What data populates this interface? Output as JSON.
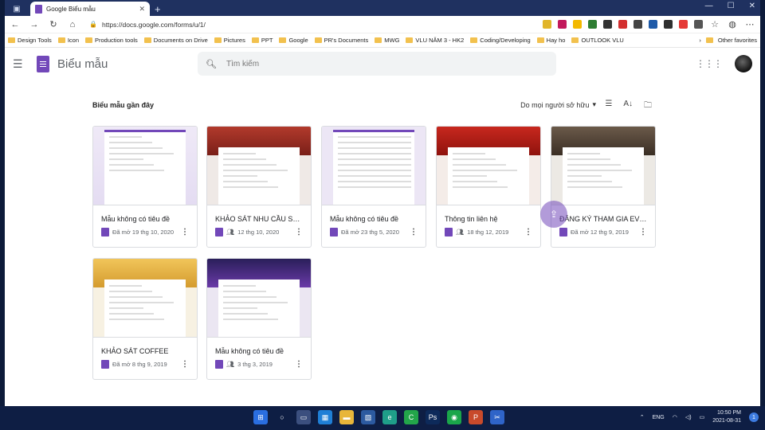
{
  "browser": {
    "tab_title": "Google Biểu mẫu",
    "tab_close": "✕",
    "new_tab": "+",
    "window_controls": [
      "—",
      "☐",
      "✕"
    ],
    "url": "https://docs.google.com/forms/u/1/",
    "bookmarks": [
      "Design Tools",
      "Icon",
      "Production tools",
      "Documents on Drive",
      "Pictures",
      "PPT",
      "Google",
      "PR's Documents",
      "MWG",
      "VLU NĂM 3 - HK2",
      "Coding/Developing",
      "Hay ho",
      "OUTLOOK VLU"
    ],
    "other_favorites": "Other favorites",
    "extension_colors": [
      "#e1b52a",
      "#c2185b",
      "#f3b900",
      "#2e7d32",
      "#333333",
      "#d32f2f",
      "#444444",
      "#1e5aa8",
      "#2f2f2f",
      "#e53935",
      "#555555"
    ]
  },
  "header": {
    "app_name": "Biểu mẫu",
    "search_placeholder": "Tìm kiếm"
  },
  "recent": {
    "title": "Biểu mẫu gần đây",
    "owner_filter": "Do mọi người sở hữu"
  },
  "forms": [
    {
      "title": "Mẫu không có tiêu đề",
      "meta": "Đã mở 19 thg 10, 2020",
      "shared": false,
      "theme": "plain"
    },
    {
      "title": "KHẢO SÁT NHU CẦU SỬ D...",
      "meta": "12 thg 10, 2020",
      "shared": true,
      "theme": "red-pattern"
    },
    {
      "title": "Mẫu không có tiêu đề",
      "meta": "Đã mở 23 thg 5, 2020",
      "shared": false,
      "theme": "grid"
    },
    {
      "title": "Thông tin liên hệ",
      "meta": "18 thg 12, 2019",
      "shared": true,
      "theme": "red-banner"
    },
    {
      "title": "ĐĂNG KÝ THAM GIA EVE...",
      "meta": "Đã mở 12 thg 9, 2019",
      "shared": false,
      "theme": "cafe"
    },
    {
      "title": "KHẢO SÁT COFFEE",
      "meta": "Đã mở 8 thg 9, 2019",
      "shared": false,
      "theme": "yellow"
    },
    {
      "title": "Mẫu không có tiêu đề",
      "meta": "3 thg 3, 2019",
      "shared": true,
      "theme": "purple-sky"
    }
  ],
  "taskbar": {
    "lang": "ENG",
    "time": "10:50 PM",
    "date": "2021-08-31",
    "notifications": "1"
  }
}
